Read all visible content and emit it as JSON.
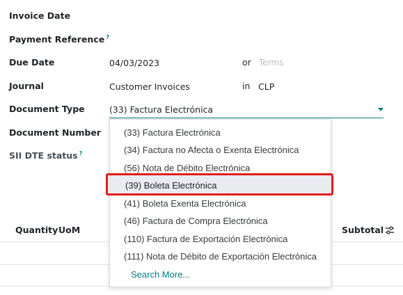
{
  "form": {
    "invoice_date_label": "Invoice Date",
    "payment_reference_label": "Payment Reference",
    "help_marker": "?",
    "due_date_label": "Due Date",
    "due_date_value": "04/03/2023",
    "or_label": "or",
    "terms_placeholder": "Terms",
    "journal_label": "Journal",
    "journal_value": "Customer Invoices",
    "in_label": "in",
    "currency_value": "CLP",
    "document_type_label": "Document Type",
    "document_type_value": "(33) Factura Electrónica",
    "document_number_label": "Document Number",
    "sii_status_label": "SII DTE status"
  },
  "table": {
    "quantity_header": "Quantity",
    "uom_header": "UoM",
    "subtotal_header": "Subtotal"
  },
  "dropdown": {
    "options": [
      "(33) Factura Electrónica",
      "(34) Factura no Afecta o Exenta Electrónica",
      "(56) Nota de Débito Electrónica",
      "(39) Boleta Electrónica",
      "(41) Boleta Exenta Electrónica",
      "(46) Factura de Compra Electrónica",
      "(110) Factura de Exportación Electrónica",
      "(111) Nota de Débito de Exportación Electrónica"
    ],
    "highlighted_index": 3,
    "search_more": "Search More..."
  },
  "colors": {
    "accent": "#017e84",
    "highlight_border": "#e31c1c"
  },
  "icons": {
    "dropdown_caret": "chevron-down-icon",
    "column_settings": "sliders-icon"
  }
}
